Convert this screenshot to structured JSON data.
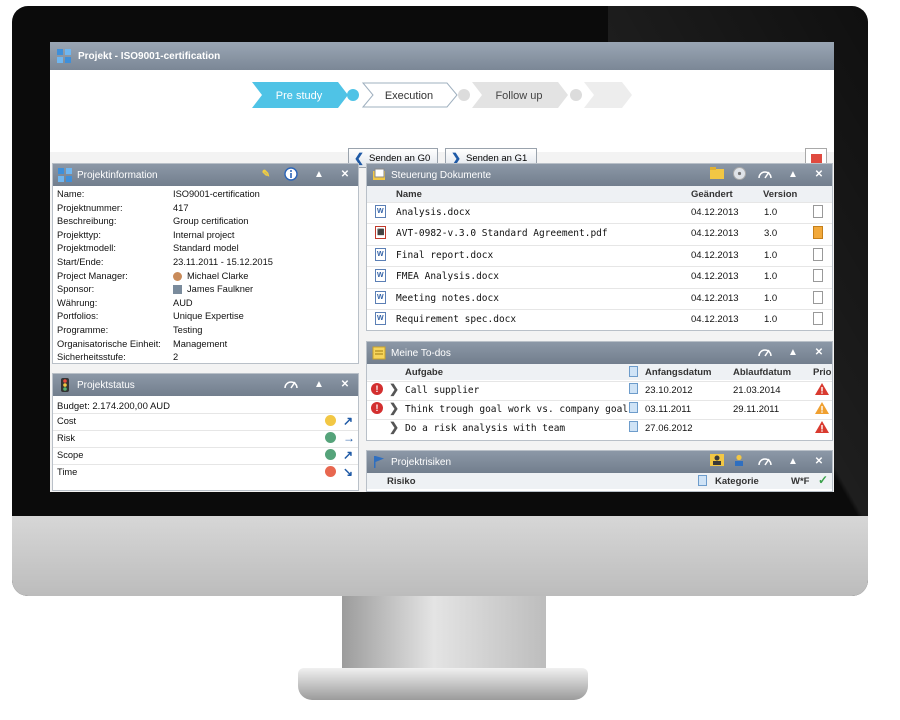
{
  "window": {
    "title": "Projekt - ISO9001-certification"
  },
  "workflow": {
    "steps": [
      {
        "label": "Pre study",
        "state": "done"
      },
      {
        "label": "Execution",
        "state": "active"
      },
      {
        "label": "Follow up",
        "state": "pending"
      }
    ],
    "buttons": {
      "send_g0": "Senden an G0",
      "send_g1": "Senden an G1"
    }
  },
  "project_info": {
    "title": "Projektinformation",
    "rows": [
      {
        "key": "Name:",
        "value": "ISO9001-certification"
      },
      {
        "key": "Projektnummer:",
        "value": "417"
      },
      {
        "key": "Beschreibung:",
        "value": "Group certification"
      },
      {
        "key": "Projekttyp:",
        "value": "Internal project"
      },
      {
        "key": "Projektmodell:",
        "value": "Standard model"
      },
      {
        "key": "Start/Ende:",
        "value": "23.11.2011 - 15.12.2015"
      },
      {
        "key": "Project Manager:",
        "value": "Michael Clarke"
      },
      {
        "key": "Sponsor:",
        "value": "James Faulkner"
      },
      {
        "key": "Währung:",
        "value": "AUD"
      },
      {
        "key": "Portfolios:",
        "value": "Unique Expertise"
      },
      {
        "key": "Programme:",
        "value": "Testing"
      },
      {
        "key": "Organisatorische Einheit:",
        "value": "Management"
      },
      {
        "key": "Sicherheitsstufe:",
        "value": "2"
      }
    ]
  },
  "project_status": {
    "title": "Projektstatus",
    "budget": "Budget: 2.174.200,00 AUD",
    "rows": [
      {
        "label": "Cost",
        "color": "#f2c744",
        "arrow": "↗"
      },
      {
        "label": "Risk",
        "color": "#55a37a",
        "arrow": "→"
      },
      {
        "label": "Scope",
        "color": "#55a37a",
        "arrow": "↗"
      },
      {
        "label": "Time",
        "color": "#e8674f",
        "arrow": "↘"
      }
    ]
  },
  "documents": {
    "title": "Steuerung Dokumente",
    "columns": {
      "name": "Name",
      "changed": "Geändert",
      "version": "Version"
    },
    "rows": [
      {
        "name": "Analysis.docx",
        "changed": "04.12.2013",
        "version": "1.0",
        "type": "word"
      },
      {
        "name": "AVT-0982-v.3.0 Standard Agreement.pdf",
        "changed": "04.12.2013",
        "version": "3.0",
        "type": "pdf"
      },
      {
        "name": "Final report.docx",
        "changed": "04.12.2013",
        "version": "1.0",
        "type": "word"
      },
      {
        "name": "FMEA Analysis.docx",
        "changed": "04.12.2013",
        "version": "1.0",
        "type": "word"
      },
      {
        "name": "Meeting notes.docx",
        "changed": "04.12.2013",
        "version": "1.0",
        "type": "word"
      },
      {
        "name": "Requirement spec.docx",
        "changed": "04.12.2013",
        "version": "1.0",
        "type": "word"
      }
    ]
  },
  "todos": {
    "title": "Meine To-dos",
    "columns": {
      "task": "Aufgabe",
      "start": "Anfangsdatum",
      "end": "Ablaufdatum",
      "prio": "Prio"
    },
    "rows": [
      {
        "task": "Call supplier",
        "start": "23.10.2012",
        "end": "21.03.2014",
        "alert": true
      },
      {
        "task": "Think trough goal work vs. company goals",
        "start": "03.11.2011",
        "end": "29.11.2011",
        "alert": true
      },
      {
        "task": "Do a risk analysis with team",
        "start": "27.06.2012",
        "end": "",
        "alert": false
      }
    ]
  },
  "risks": {
    "title": "Projektrisiken",
    "columns": {
      "risk": "Risiko",
      "category": "Kategorie",
      "wf": "W*F"
    }
  }
}
